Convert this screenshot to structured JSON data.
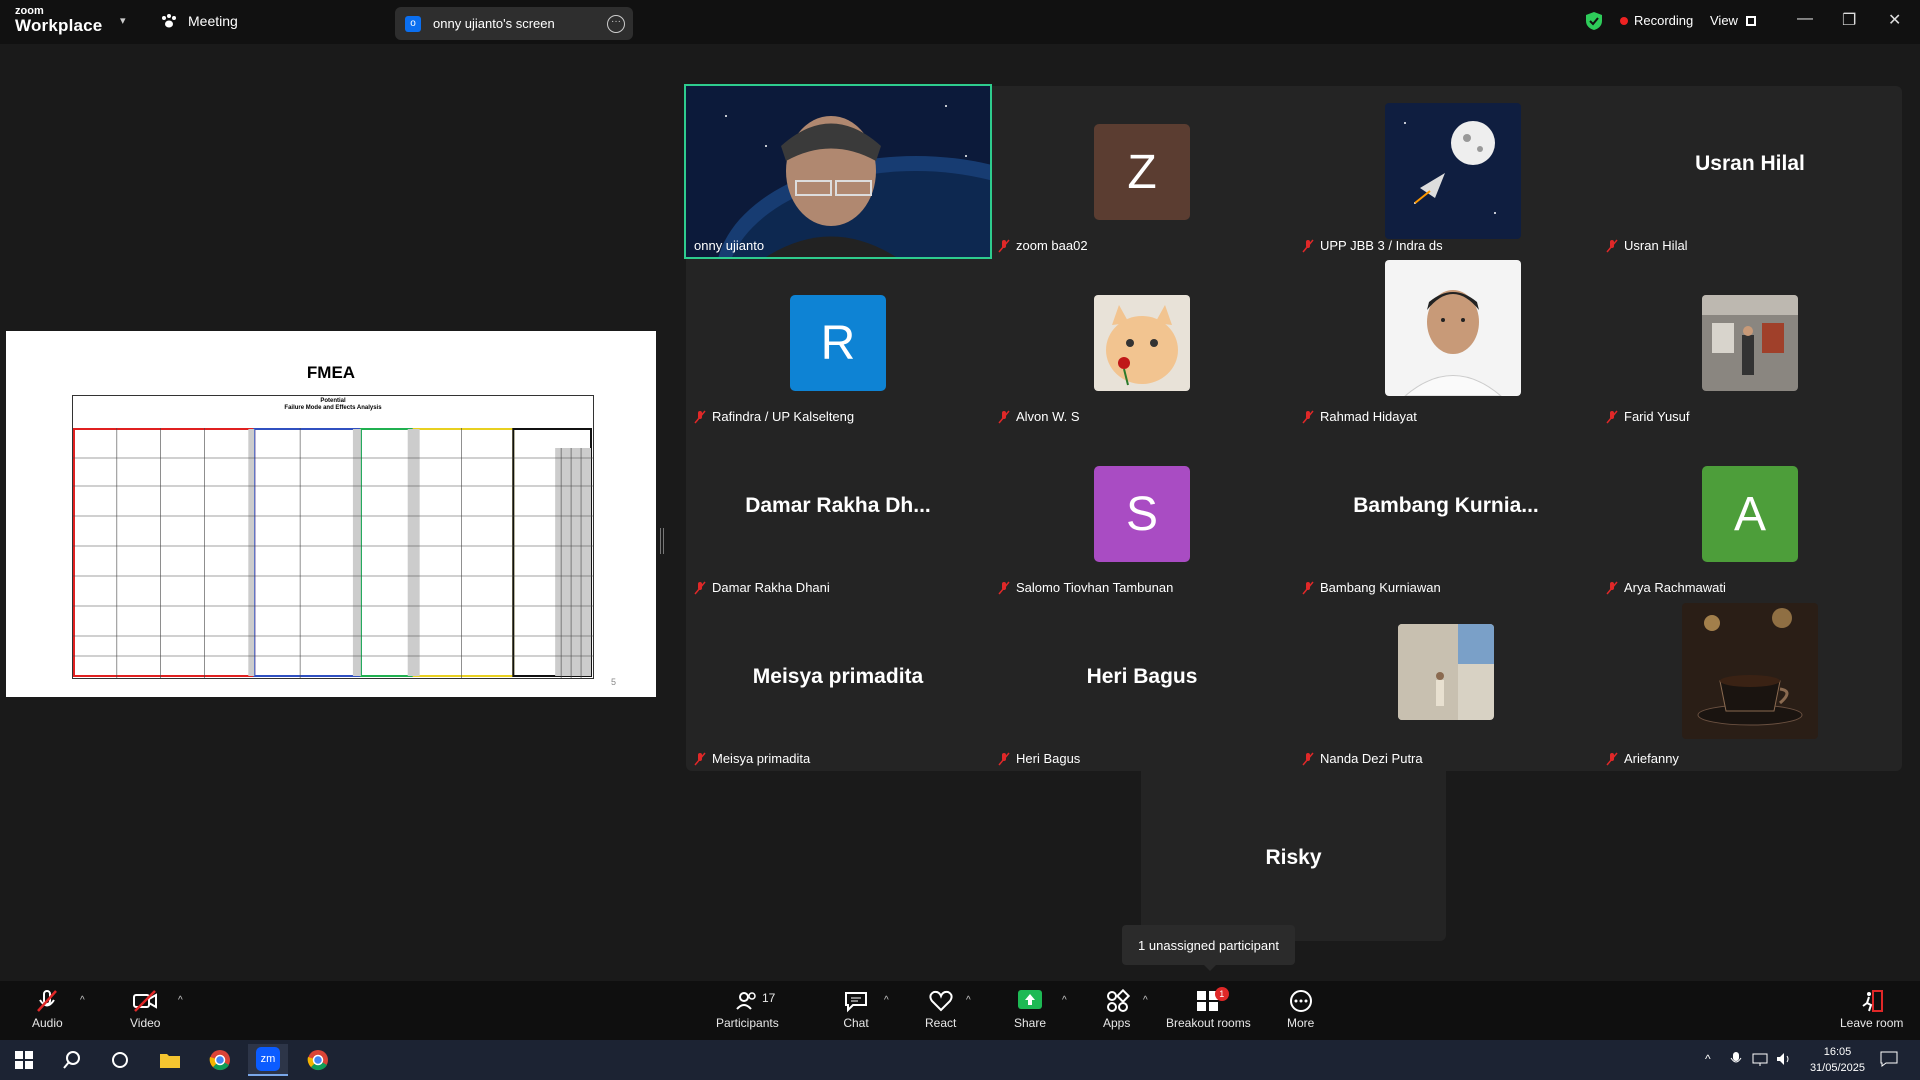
{
  "titlebar": {
    "brand_top": "zoom",
    "brand_bottom": "Workplace",
    "meeting_label": "Meeting",
    "screen_share_label": "onny ujianto's screen",
    "screen_share_badge": "o",
    "recording_label": "Recording",
    "view_label": "View"
  },
  "shared_screen": {
    "title": "FMEA",
    "sheet_title_1": "Potential",
    "sheet_title_2": "Failure Mode and Effects Analysis",
    "page_number": "5"
  },
  "participants": [
    {
      "name": "onny ujianto",
      "type": "video",
      "muted": false,
      "active": true
    },
    {
      "name": "zoom baa02",
      "type": "letter",
      "letter": "Z",
      "color": "#5b3d31",
      "muted": true
    },
    {
      "name": "UPP JBB 3 / Indra ds",
      "type": "image",
      "icon": "moon-rocket-image",
      "muted": true
    },
    {
      "name": "Usran Hilal",
      "type": "text",
      "display": "Usran Hilal",
      "muted": true
    },
    {
      "name": "Rafindra / UP Kalselteng",
      "type": "letter",
      "letter": "R",
      "color": "#0e83d4",
      "muted": true
    },
    {
      "name": "Alvon W. S",
      "type": "image",
      "icon": "cat-rose-image",
      "muted": true
    },
    {
      "name": "Rahmad Hidayat",
      "type": "image",
      "icon": "portrait-photo",
      "muted": true
    },
    {
      "name": "Farid Yusuf",
      "type": "image",
      "icon": "gallery-photo",
      "muted": true
    },
    {
      "name": "Damar Rakha Dhani",
      "type": "text",
      "display": "Damar Rakha Dh...",
      "muted": true
    },
    {
      "name": "Salomo Tiovhan Tambunan",
      "type": "letter",
      "letter": "S",
      "color": "#a94cc3",
      "muted": true
    },
    {
      "name": "Bambang Kurniawan",
      "type": "text",
      "display": "Bambang Kurnia...",
      "muted": true
    },
    {
      "name": "Arya Rachmawati",
      "type": "letter",
      "letter": "A",
      "color": "#4d9e3a",
      "muted": true
    },
    {
      "name": "Meisya primadita",
      "type": "text",
      "display": "Meisya primadita",
      "muted": true
    },
    {
      "name": "Heri Bagus",
      "type": "text",
      "display": "Heri Bagus",
      "muted": true
    },
    {
      "name": "Nanda Dezi Putra",
      "type": "image",
      "icon": "wall-photo",
      "muted": true
    },
    {
      "name": "Ariefanny",
      "type": "image",
      "icon": "coffee-cup-image",
      "muted": true
    }
  ],
  "extra_tile": {
    "display": "Risky"
  },
  "tooltip": "1 unassigned participant",
  "toolbar": {
    "audio": "Audio",
    "video": "Video",
    "participants": "Participants",
    "participants_count": "17",
    "chat": "Chat",
    "react": "React",
    "share": "Share",
    "apps": "Apps",
    "breakout": "Breakout rooms",
    "breakout_badge": "1",
    "more": "More",
    "leave": "Leave room"
  },
  "taskbar": {
    "time": "16:05",
    "date": "31/05/2025",
    "zoom_app_label": "zm"
  },
  "colors": {
    "active_speaker": "#2ecc8e",
    "share_green": "#1db954",
    "muted_red": "#e02828"
  }
}
